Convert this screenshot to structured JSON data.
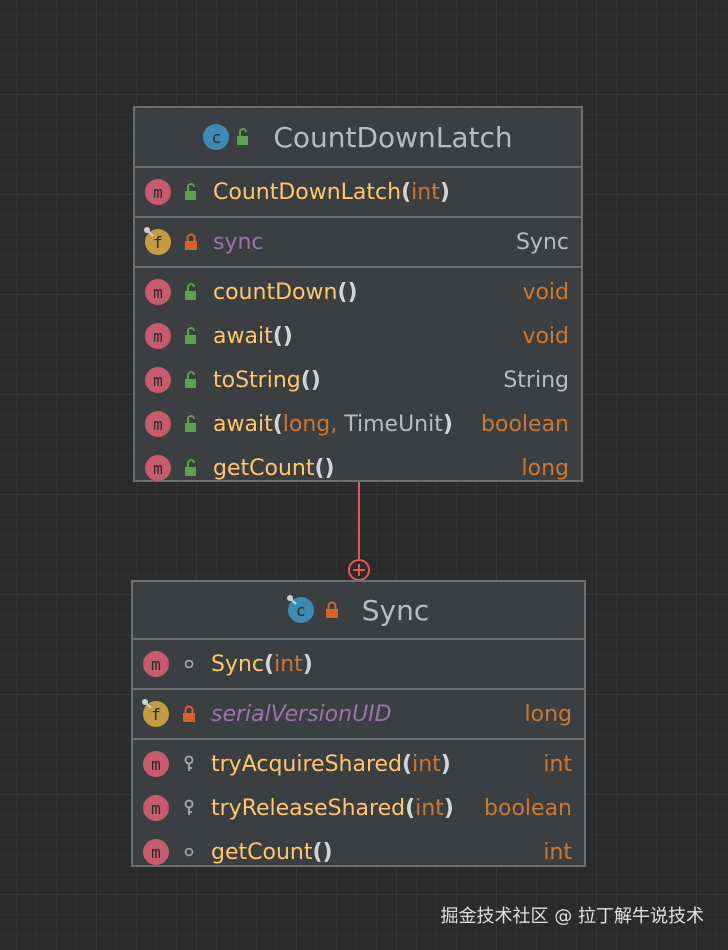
{
  "classes": [
    {
      "name": "CountDownLatch",
      "constructors": [
        {
          "name": "CountDownLatch",
          "open": "(",
          "params": [
            {
              "t": "int",
              "kw": true
            }
          ],
          "close": ")"
        }
      ],
      "fields": [
        {
          "name": "sync",
          "type": "Sync"
        }
      ],
      "methods": [
        {
          "name": "countDown",
          "call": "()",
          "type": "void"
        },
        {
          "name": "await",
          "call": "()",
          "type": "void"
        },
        {
          "name": "toString",
          "call": "()",
          "type": "String"
        },
        {
          "name": "await",
          "open": "(",
          "p1": "long",
          "comma": ",",
          "p2": " TimeUnit",
          "close": ")",
          "type": "boolean"
        },
        {
          "name": "getCount",
          "call": "()",
          "type": "long"
        }
      ]
    },
    {
      "name": "Sync",
      "constructors": [
        {
          "name": "Sync",
          "open": "(",
          "param": "int",
          "close": ")"
        }
      ],
      "fields": [
        {
          "name": "serialVersionUID",
          "type": "long"
        }
      ],
      "methods": [
        {
          "name": "tryAcquireShared",
          "open": "(",
          "param": "int",
          "close": ")",
          "type": "int"
        },
        {
          "name": "tryReleaseShared",
          "open": "(",
          "param": "int",
          "close": ")",
          "type": "boolean"
        },
        {
          "name": "getCount",
          "call": "()",
          "type": "int"
        }
      ]
    }
  ],
  "icons": {
    "class": "c",
    "method": "m",
    "field": "f"
  },
  "colors": {
    "connector": "#e05a5a",
    "method_name": "#ffc66d",
    "keyword": "#cc7832",
    "field": "#9876aa"
  },
  "watermark": "掘金技术社区 @ 拉丁解牛说技术"
}
